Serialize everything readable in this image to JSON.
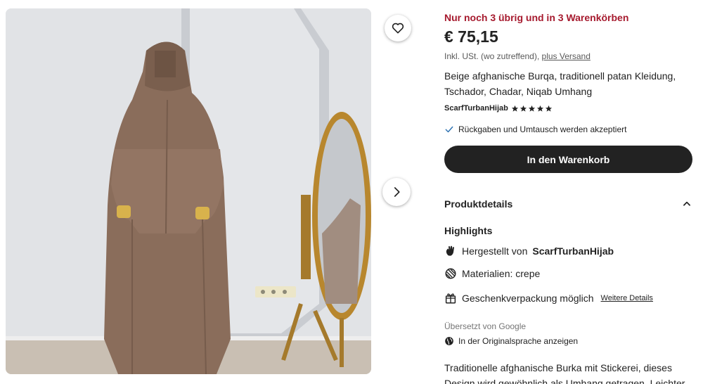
{
  "listing": {
    "stock_notice": "Nur noch 3 übrig und in 3 Warenkörben",
    "price": "€ 75,15",
    "tax_note": "Inkl. USt. (wo zutreffend),",
    "shipping_link": "plus Versand",
    "title": "Beige afghanische Burqa, traditionell patan Kleidung, Tschador, Chadar, Niqab Umhang",
    "shop_name": "ScarfTurbanHijab",
    "rating_stars": 5,
    "returns_text": "Rückgaben und Umtausch werden akzeptiert",
    "add_to_cart_label": "In den Warenkorb"
  },
  "details": {
    "section_label": "Produktdetails",
    "highlights_label": "Highlights",
    "made_by_prefix": "Hergestellt von",
    "made_by_shop": "ScarfTurbanHijab",
    "materials": "Materialien: crepe",
    "gift_wrap": "Geschenkverpackung möglich",
    "more_details_link": "Weitere Details"
  },
  "translation": {
    "translated_by": "Übersetzt von Google",
    "show_original": "In der Originalsprache anzeigen"
  },
  "description": {
    "line1": "Traditionelle afghanische Burka mit Stickerei, dieses",
    "line2": "Design wird gewöhnlich als Umhang getragen. Leichter"
  },
  "icons": {
    "favorite": "heart-icon",
    "next_image": "chevron-right-icon",
    "returns": "check-icon",
    "collapse": "chevron-up-icon",
    "made_by": "hand-wave-icon",
    "materials": "fabric-icon",
    "gift": "gift-icon",
    "language": "globe-icon",
    "rating": "star-icon"
  },
  "colors": {
    "stock_notice": "#a61a2e",
    "button_bg": "#222222",
    "text": "#222222",
    "muted": "#757575"
  }
}
